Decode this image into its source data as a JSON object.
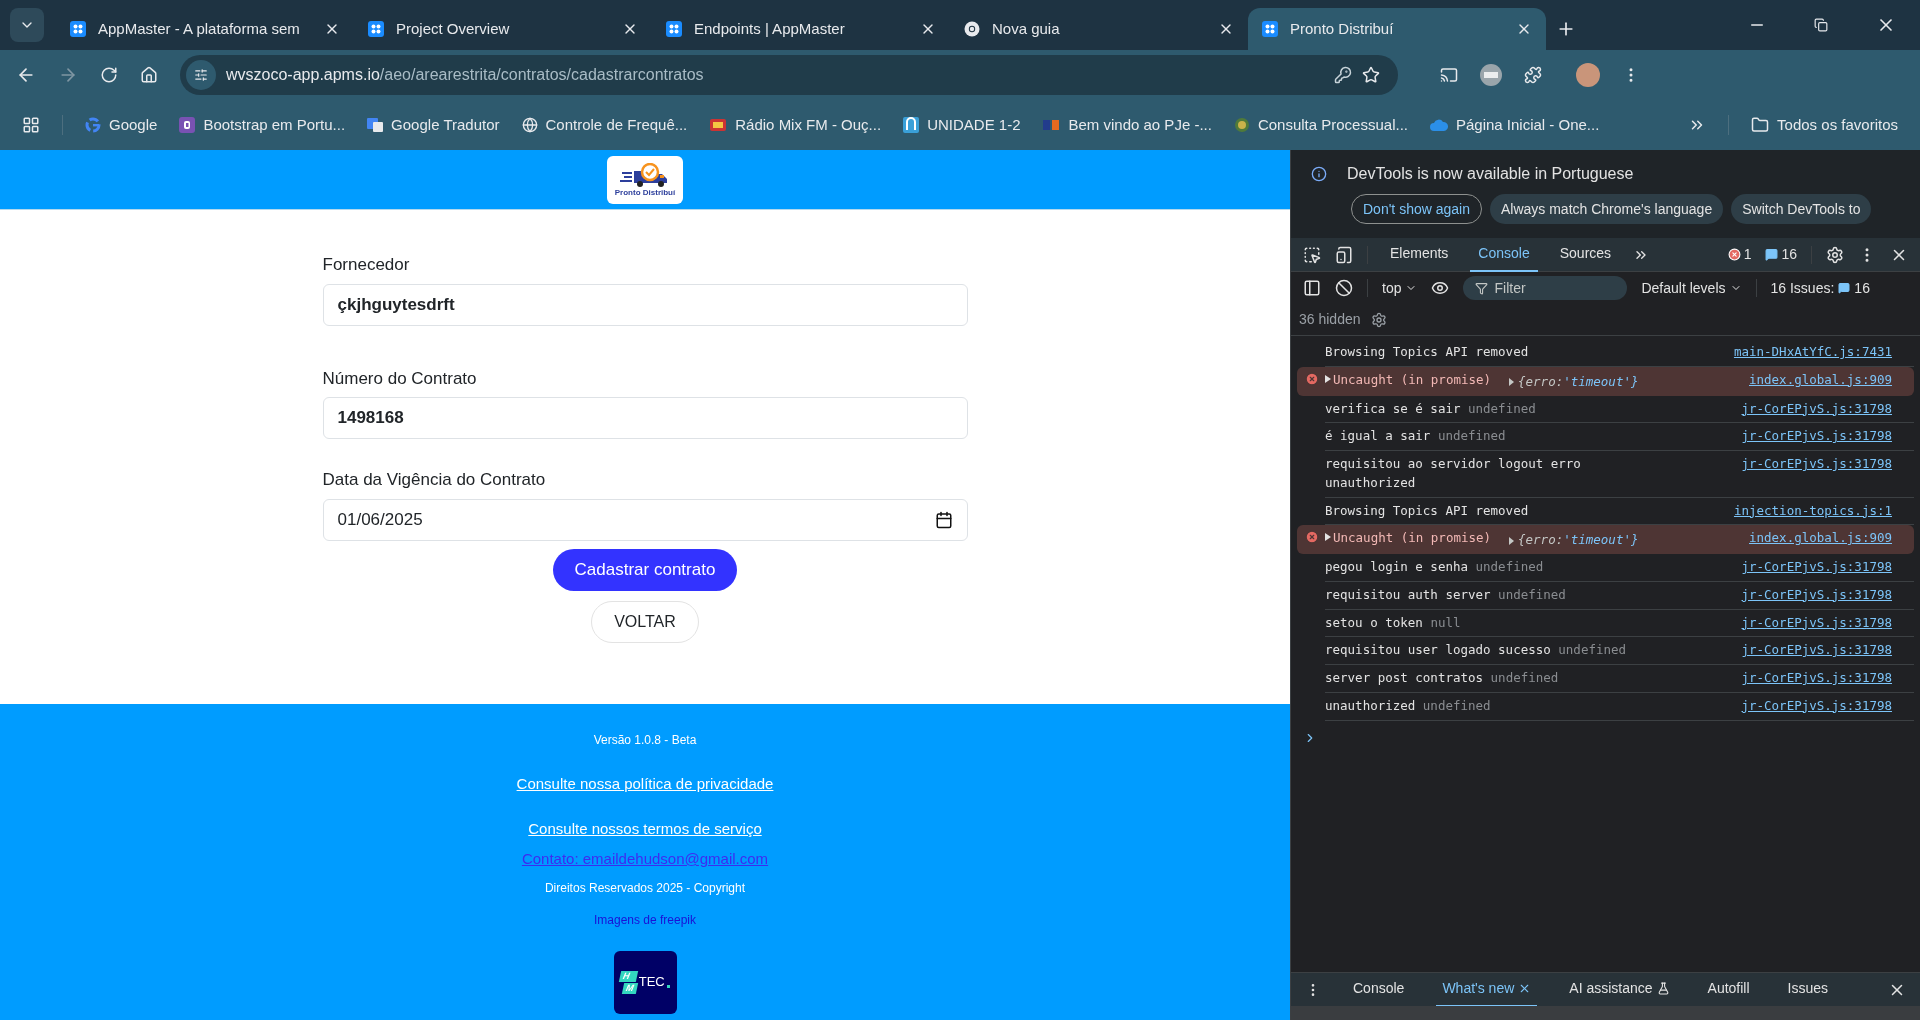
{
  "browser": {
    "tabs": [
      {
        "title": "AppMaster - A plataforma sem",
        "selected": false
      },
      {
        "title": "Project Overview",
        "selected": false
      },
      {
        "title": "Endpoints | AppMaster",
        "selected": false
      },
      {
        "title": "Nova guia",
        "selected": false
      },
      {
        "title": "Pronto Distribuí",
        "selected": true
      }
    ],
    "url_host": "wvszoco-app.apms.io",
    "url_path": "/aeo/arearestrita/contratos/cadastrarcontratos",
    "bookmarks": [
      {
        "label": "Google"
      },
      {
        "label": "Bootstrap em Portu..."
      },
      {
        "label": "Google Tradutor"
      },
      {
        "label": "Controle de Frequê..."
      },
      {
        "label": "Rádio Mix FM - Ouç..."
      },
      {
        "label": "UNIDADE 1-2"
      },
      {
        "label": "Bem vindo ao PJe -..."
      },
      {
        "label": "Consulta Processual..."
      },
      {
        "label": "Página Inicial - One..."
      }
    ],
    "all_bookmarks": "Todos os favoritos"
  },
  "page": {
    "logo_text": "Pronto Distribuí",
    "fields": [
      {
        "label": "Fornecedor",
        "value": "çkjhguytesdrft",
        "kind": "text"
      },
      {
        "label": "Número do Contrato",
        "value": "1498168",
        "kind": "text"
      },
      {
        "label": "Data da Vigência do Contrato",
        "value": "01/06/2025",
        "kind": "date"
      }
    ],
    "submit": "Cadastrar contrato",
    "back": "VOLTAR",
    "footer": {
      "version": "Versão 1.0.8 - Beta",
      "privacy": "Consulte nossa política de privacidade",
      "terms": "Consulte nossos termos de serviço",
      "contact": "Contato: emaildehudson@gmail.com",
      "rights": "Direitos Reservados 2025 - Copyright",
      "credits": "Imagens de freepik",
      "logo_letters": [
        "H",
        "M"
      ],
      "logo_word": "TEC"
    }
  },
  "devtools": {
    "notice": "DevTools is now available in Portuguese",
    "notice_buttons": [
      {
        "label": "Don't show again",
        "kind": "outline"
      },
      {
        "label": "Always match Chrome's language",
        "kind": "filled"
      },
      {
        "label": "Switch DevTools to",
        "kind": "filled"
      }
    ],
    "tabs": [
      {
        "label": "Elements",
        "selected": false
      },
      {
        "label": "Console",
        "selected": true
      },
      {
        "label": "Sources",
        "selected": false
      }
    ],
    "error_count": "1",
    "message_count": "16",
    "context": "top",
    "filter_placeholder": "Filter",
    "levels": "Default levels",
    "issues_label": "16 Issues:",
    "issues_count": "16",
    "hidden": "36 hidden",
    "messages": [
      {
        "kind": "log",
        "text": "Browsing Topics API removed",
        "source": "main-DHxAtYfC.js:7431"
      },
      {
        "kind": "error",
        "text": "Uncaught (in promise)",
        "obj_key": "{erro:",
        "obj_value": "'timeout'}",
        "source": "index.global.js:909"
      },
      {
        "kind": "log",
        "text": "verifica se é sair",
        "detail": "undefined",
        "source": "jr-CorEPjvS.js:31798"
      },
      {
        "kind": "log",
        "text": "é igual a sair",
        "detail": "undefined",
        "source": "jr-CorEPjvS.js:31798"
      },
      {
        "kind": "log",
        "text": "requisitou ao servidor logout erro unauthorized",
        "source": "jr-CorEPjvS.js:31798"
      },
      {
        "kind": "log",
        "text": "Browsing Topics API removed",
        "source": "injection-topics.js:1"
      },
      {
        "kind": "error",
        "text": "Uncaught (in promise)",
        "obj_key": "{erro:",
        "obj_value": "'timeout'}",
        "source": "index.global.js:909"
      },
      {
        "kind": "log",
        "text": "pegou login e senha",
        "detail": "undefined",
        "source": "jr-CorEPjvS.js:31798"
      },
      {
        "kind": "log",
        "text": "requisitou auth server",
        "detail": "undefined",
        "source": "jr-CorEPjvS.js:31798"
      },
      {
        "kind": "log",
        "text": "setou o token",
        "detail": "null",
        "source": "jr-CorEPjvS.js:31798"
      },
      {
        "kind": "log",
        "text": "requisitou user logado sucesso",
        "detail": "undefined",
        "source": "jr-CorEPjvS.js:31798"
      },
      {
        "kind": "log",
        "text": "server post contratos",
        "detail": "undefined",
        "source": "jr-CorEPjvS.js:31798"
      },
      {
        "kind": "log",
        "text": "unauthorized",
        "detail": "undefined",
        "source": "jr-CorEPjvS.js:31798"
      }
    ],
    "drawer_tabs": [
      {
        "label": "Console",
        "selected": false
      },
      {
        "label": "What's new",
        "selected": true
      },
      {
        "label": "AI assistance",
        "selected": false
      },
      {
        "label": "Autofill",
        "selected": false
      },
      {
        "label": "Issues",
        "selected": false
      }
    ]
  }
}
